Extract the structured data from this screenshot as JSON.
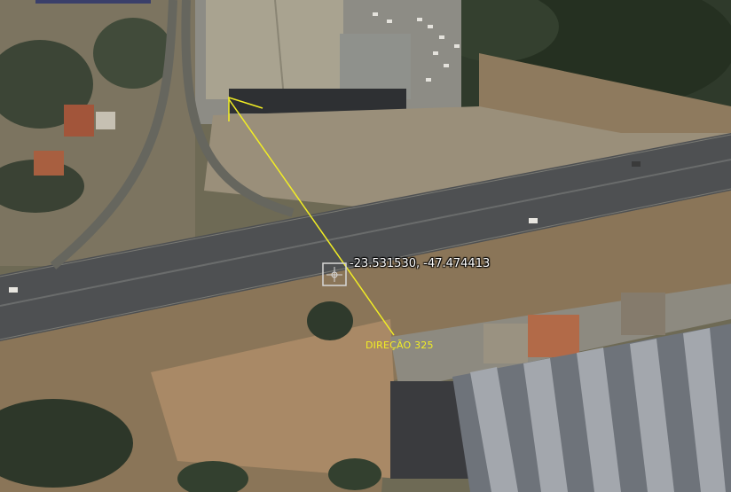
{
  "map": {
    "coordinates": "-23.531530, -47.474413",
    "direction_label": "DIREÇÃO 325"
  },
  "colors": {
    "arrow": "#f2ee24",
    "coordinate_text": "#ffffff",
    "crosshair": "#d8d8d8"
  }
}
